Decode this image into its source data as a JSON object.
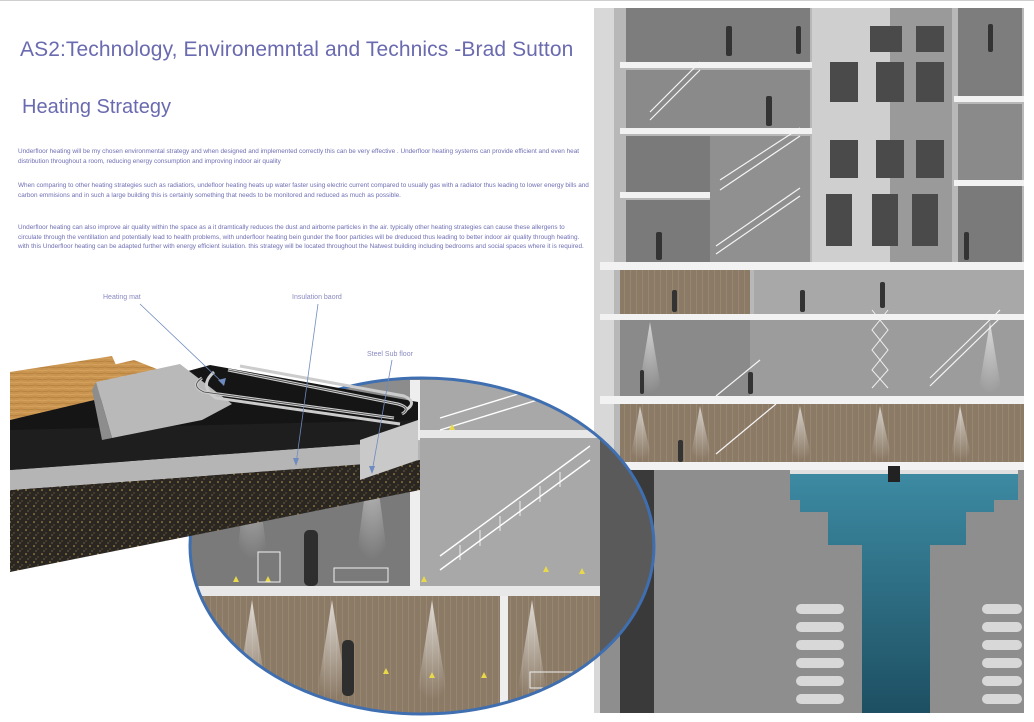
{
  "title": "AS2:Technology, Environemntal and Technics -Brad Sutton",
  "subtitle": "Heating Strategy",
  "paragraphs": [
    "Underfloor heating will be my chosen environmental strategy and when designed and implemented correctly this can be very effective . Underfloor heating systems can provide efficient and even heat distribution throughout a room, reducing energy consumption and improving indoor air quality",
    "When comparing to other heating strategies such as radiatiors, undefloor heating heats up water faster using electric current compared to usually gas with a radiator thus leading to lower energy bills and carbon emmisions and in such a large building this is certainly something that needs to be monitored and reduced as much as possible.",
    "Underfloor  heating can also improve air quality within the space as a it dramtically reduces the dust and airborne particles in the air. typically other heating strategies can cause these allergens to circulate through the ventillation and potentially lead to health problems, with underfloor heating bein gunder the floor particles will be dreduced thus leading to better indoor air quality through heating. with this Underfloor heating can be adapted further with energy efficient isulation. this strategy will be located throughout the Natwest building including bedrooms and social spaces where it is required."
  ],
  "callouts": {
    "heating_mat": "Heating mat",
    "insulation": "Insulation baord",
    "steel_floor": "Steel Sub floor"
  },
  "colors": {
    "accent_text": "#6a6ab0",
    "circle_border": "#3f6fb0",
    "pool_water": "#2f6f86",
    "concrete": "#9a9a9a",
    "timber": "#c89a5a"
  }
}
